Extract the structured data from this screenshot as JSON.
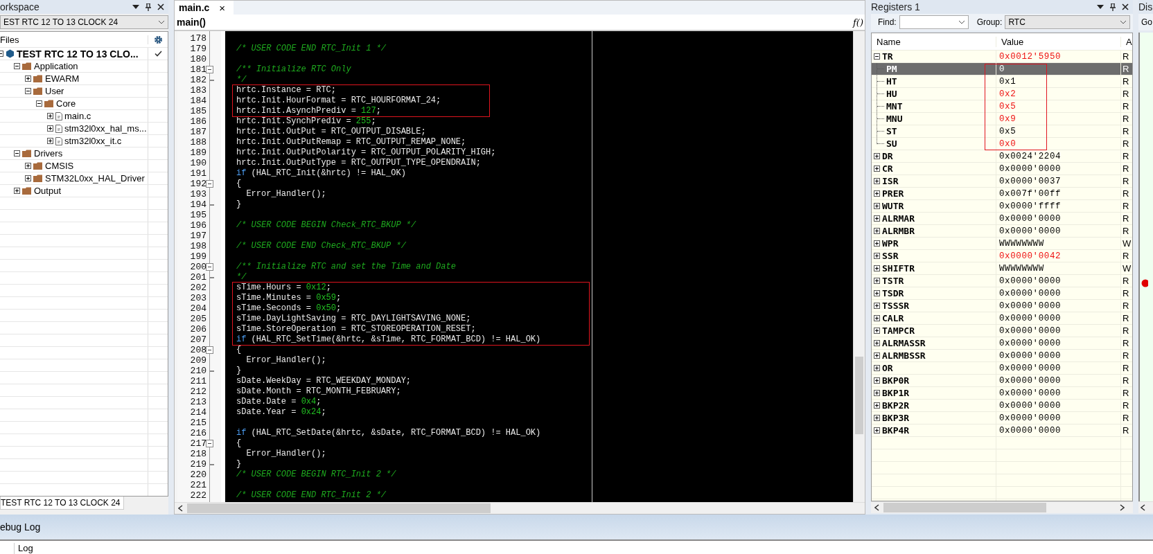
{
  "workspace": {
    "title": "orkspace",
    "configuration": "EST RTC 12 TO 13 CLOCK 24",
    "files_header": "Files",
    "tree": [
      {
        "label": "TEST RTC 12 TO 13 CLO...",
        "kind": "project",
        "expanded": true,
        "checked": true,
        "children": [
          {
            "label": "Application",
            "kind": "folder",
            "expanded": true,
            "children": [
              {
                "label": "EWARM",
                "kind": "folder",
                "expanded": false
              },
              {
                "label": "User",
                "kind": "folder",
                "expanded": true,
                "children": [
                  {
                    "label": "Core",
                    "kind": "folder",
                    "expanded": true,
                    "children": [
                      {
                        "label": "main.c",
                        "kind": "file",
                        "expanded": false
                      },
                      {
                        "label": "stm32l0xx_hal_ms...",
                        "kind": "file",
                        "expanded": false
                      },
                      {
                        "label": "stm32l0xx_it.c",
                        "kind": "file",
                        "expanded": false
                      }
                    ]
                  }
                ]
              }
            ]
          },
          {
            "label": "Drivers",
            "kind": "folder",
            "expanded": true,
            "children": [
              {
                "label": "CMSIS",
                "kind": "folder",
                "expanded": false
              },
              {
                "label": "STM32L0xx_HAL_Driver",
                "kind": "folder",
                "expanded": false
              }
            ]
          },
          {
            "label": "Output",
            "kind": "folder",
            "expanded": false
          }
        ]
      }
    ],
    "bottom_tab": "TEST RTC 12 TO 13 CLOCK 24"
  },
  "editor": {
    "tabs": [
      {
        "label": "main.c",
        "close": "×",
        "selected": true
      }
    ],
    "function": "main()",
    "function_button": "f()",
    "blocks": [
      {
        "boxed": false,
        "lines": [
          {
            "number": "178"
          },
          {
            "number": "179",
            "segments": [
              {
                "kind": "comment",
                "text": "/* USER CODE END RTC_Init 1 */"
              }
            ]
          },
          {
            "number": "180"
          },
          {
            "number": "181",
            "collapsible": true,
            "segments": [
              {
                "kind": "comment",
                "text": "/** Initialize RTC Only"
              }
            ]
          },
          {
            "number": "182",
            "block_end": true,
            "segments": [
              {
                "kind": "comment",
                "text": "*/"
              }
            ]
          }
        ]
      },
      {
        "boxed": true,
        "lines": [
          {
            "number": "183",
            "segments": [
              {
                "kind": "plain",
                "text": "hrtc.Instance = RTC;"
              }
            ]
          },
          {
            "number": "184",
            "segments": [
              {
                "kind": "plain",
                "text": "hrtc.Init.HourFormat = RTC_HOURFORMAT_24;"
              }
            ]
          },
          {
            "number": "185",
            "segments": [
              {
                "kind": "plain",
                "text": "hrtc.Init.AsynchPrediv = "
              },
              {
                "kind": "number",
                "text": "127"
              },
              {
                "kind": "plain",
                "text": ";"
              }
            ]
          }
        ]
      },
      {
        "boxed": false,
        "lines": [
          {
            "number": "186",
            "segments": [
              {
                "kind": "plain",
                "text": "hrtc.Init.SynchPrediv = "
              },
              {
                "kind": "number",
                "text": "255"
              },
              {
                "kind": "plain",
                "text": ";"
              }
            ]
          },
          {
            "number": "187",
            "segments": [
              {
                "kind": "plain",
                "text": "hrtc.Init.OutPut = RTC_OUTPUT_DISABLE;"
              }
            ]
          },
          {
            "number": "188",
            "segments": [
              {
                "kind": "plain",
                "text": "hrtc.Init.OutPutRemap = RTC_OUTPUT_REMAP_NONE;"
              }
            ]
          },
          {
            "number": "189",
            "segments": [
              {
                "kind": "plain",
                "text": "hrtc.Init.OutPutPolarity = RTC_OUTPUT_POLARITY_HIGH;"
              }
            ]
          },
          {
            "number": "190",
            "segments": [
              {
                "kind": "plain",
                "text": "hrtc.Init.OutPutType = RTC_OUTPUT_TYPE_OPENDRAIN;"
              }
            ]
          },
          {
            "number": "191",
            "segments": [
              {
                "kind": "keyword",
                "text": "if"
              },
              {
                "kind": "plain",
                "text": " (HAL_RTC_Init(&hrtc) != HAL_OK)"
              }
            ]
          },
          {
            "number": "192",
            "collapsible": true,
            "segments": [
              {
                "kind": "plain",
                "text": "{"
              }
            ]
          },
          {
            "number": "193",
            "segments": [
              {
                "kind": "plain",
                "text": "  Error_Handler();"
              }
            ]
          },
          {
            "number": "194",
            "block_end": true,
            "segments": [
              {
                "kind": "plain",
                "text": "}"
              }
            ]
          },
          {
            "number": "195"
          },
          {
            "number": "196",
            "segments": [
              {
                "kind": "comment",
                "text": "/* USER CODE BEGIN Check_RTC_BKUP */"
              }
            ]
          },
          {
            "number": "197"
          },
          {
            "number": "198",
            "segments": [
              {
                "kind": "comment",
                "text": "/* USER CODE END Check_RTC_BKUP */"
              }
            ]
          },
          {
            "number": "199"
          },
          {
            "number": "200",
            "collapsible": true,
            "segments": [
              {
                "kind": "comment",
                "text": "/** Initialize RTC and set the Time and Date"
              }
            ]
          },
          {
            "number": "201",
            "block_end": true,
            "segments": [
              {
                "kind": "comment",
                "text": "*/"
              }
            ]
          }
        ]
      },
      {
        "boxed": true,
        "lines": [
          {
            "number": "202",
            "segments": [
              {
                "kind": "plain",
                "text": "sTime.Hours = "
              },
              {
                "kind": "number",
                "text": "0x12"
              },
              {
                "kind": "plain",
                "text": ";"
              }
            ]
          },
          {
            "number": "203",
            "segments": [
              {
                "kind": "plain",
                "text": "sTime.Minutes = "
              },
              {
                "kind": "number",
                "text": "0x59"
              },
              {
                "kind": "plain",
                "text": ";"
              }
            ]
          },
          {
            "number": "204",
            "segments": [
              {
                "kind": "plain",
                "text": "sTime.Seconds = "
              },
              {
                "kind": "number",
                "text": "0x50"
              },
              {
                "kind": "plain",
                "text": ";"
              }
            ]
          },
          {
            "number": "205",
            "segments": [
              {
                "kind": "plain",
                "text": "sTime.DayLightSaving = RTC_DAYLIGHTSAVING_NONE;"
              }
            ]
          },
          {
            "number": "206",
            "segments": [
              {
                "kind": "plain",
                "text": "sTime.StoreOperation = RTC_STOREOPERATION_RESET;"
              }
            ]
          },
          {
            "number": "207",
            "segments": [
              {
                "kind": "keyword",
                "text": "if"
              },
              {
                "kind": "plain",
                "text": " (HAL_RTC_SetTime(&hrtc, &sTime, RTC_FORMAT_BCD) != HAL_OK)"
              }
            ]
          }
        ]
      },
      {
        "boxed": false,
        "lines": [
          {
            "number": "208",
            "collapsible": true,
            "segments": [
              {
                "kind": "plain",
                "text": "{"
              }
            ]
          },
          {
            "number": "209",
            "segments": [
              {
                "kind": "plain",
                "text": "  Error_Handler();"
              }
            ]
          },
          {
            "number": "210",
            "block_end": true,
            "segments": [
              {
                "kind": "plain",
                "text": "}"
              }
            ]
          },
          {
            "number": "211",
            "segments": [
              {
                "kind": "plain",
                "text": "sDate.WeekDay = RTC_WEEKDAY_MONDAY;"
              }
            ]
          },
          {
            "number": "212",
            "segments": [
              {
                "kind": "plain",
                "text": "sDate.Month = RTC_MONTH_FEBRUARY;"
              }
            ]
          },
          {
            "number": "213",
            "segments": [
              {
                "kind": "plain",
                "text": "sDate.Date = "
              },
              {
                "kind": "number",
                "text": "0x4"
              },
              {
                "kind": "plain",
                "text": ";"
              }
            ]
          },
          {
            "number": "214",
            "segments": [
              {
                "kind": "plain",
                "text": "sDate.Year = "
              },
              {
                "kind": "number",
                "text": "0x24"
              },
              {
                "kind": "plain",
                "text": ";"
              }
            ]
          },
          {
            "number": "215"
          },
          {
            "number": "216",
            "segments": [
              {
                "kind": "keyword",
                "text": "if"
              },
              {
                "kind": "plain",
                "text": " (HAL_RTC_SetDate(&hrtc, &sDate, RTC_FORMAT_BCD) != HAL_OK)"
              }
            ]
          },
          {
            "number": "217",
            "collapsible": true,
            "segments": [
              {
                "kind": "plain",
                "text": "{"
              }
            ]
          },
          {
            "number": "218",
            "segments": [
              {
                "kind": "plain",
                "text": "  Error_Handler();"
              }
            ]
          },
          {
            "number": "219",
            "block_end": true,
            "segments": [
              {
                "kind": "plain",
                "text": "}"
              }
            ]
          },
          {
            "number": "220",
            "segments": [
              {
                "kind": "comment",
                "text": "/* USER CODE BEGIN RTC_Init 2 */"
              }
            ]
          },
          {
            "number": "221"
          },
          {
            "number": "222",
            "segments": [
              {
                "kind": "comment",
                "text": "/* USER CODE END RTC_Init 2 */"
              }
            ]
          }
        ]
      }
    ]
  },
  "registers": {
    "title": "Registers 1",
    "find_label": "Find:",
    "group_label": "Group:",
    "group_value": "RTC",
    "columns": [
      "Name",
      "Value",
      "A"
    ],
    "rows": [
      {
        "name": "TR",
        "value": "0x0012'5950",
        "access": "R",
        "changed": true,
        "selected": false,
        "expanded": true,
        "children_boxed": true,
        "children": [
          {
            "name": "PM",
            "value": "0",
            "access": "R",
            "changed": false,
            "selected": true
          },
          {
            "name": "HT",
            "value": "0x1",
            "access": "R",
            "changed": false,
            "selected": false
          },
          {
            "name": "HU",
            "value": "0x2",
            "access": "R",
            "changed": true,
            "selected": false
          },
          {
            "name": "MNT",
            "value": "0x5",
            "access": "R",
            "changed": true,
            "selected": false
          },
          {
            "name": "MNU",
            "value": "0x9",
            "access": "R",
            "changed": true,
            "selected": false
          },
          {
            "name": "ST",
            "value": "0x5",
            "access": "R",
            "changed": false,
            "selected": false
          },
          {
            "name": "SU",
            "value": "0x0",
            "access": "R",
            "changed": true,
            "selected": false
          }
        ]
      },
      {
        "name": "DR",
        "value": "0x0024'2204",
        "access": "R",
        "changed": false,
        "selected": false,
        "expanded": false
      },
      {
        "name": "CR",
        "value": "0x0000'0000",
        "access": "R",
        "changed": false,
        "selected": false,
        "expanded": false
      },
      {
        "name": "ISR",
        "value": "0x0000'0037",
        "access": "R",
        "changed": false,
        "selected": false,
        "expanded": false
      },
      {
        "name": "PRER",
        "value": "0x007f'00ff",
        "access": "R",
        "changed": false,
        "selected": false,
        "expanded": false
      },
      {
        "name": "WUTR",
        "value": "0x0000'ffff",
        "access": "R",
        "changed": false,
        "selected": false,
        "expanded": false
      },
      {
        "name": "ALRMAR",
        "value": "0x0000'0000",
        "access": "R",
        "changed": false,
        "selected": false,
        "expanded": false
      },
      {
        "name": "ALRMBR",
        "value": "0x0000'0000",
        "access": "R",
        "changed": false,
        "selected": false,
        "expanded": false
      },
      {
        "name": "WPR",
        "value": "WWWWWWWW",
        "access": "W",
        "changed": false,
        "selected": false,
        "expanded": false
      },
      {
        "name": "SSR",
        "value": "0x0000'0042",
        "access": "R",
        "changed": true,
        "selected": false,
        "expanded": false
      },
      {
        "name": "SHIFTR",
        "value": "WWWWWWWW",
        "access": "W",
        "changed": false,
        "selected": false,
        "expanded": false
      },
      {
        "name": "TSTR",
        "value": "0x0000'0000",
        "access": "R",
        "changed": false,
        "selected": false,
        "expanded": false
      },
      {
        "name": "TSDR",
        "value": "0x0000'0000",
        "access": "R",
        "changed": false,
        "selected": false,
        "expanded": false
      },
      {
        "name": "TSSSR",
        "value": "0x0000'0000",
        "access": "R",
        "changed": false,
        "selected": false,
        "expanded": false
      },
      {
        "name": "CALR",
        "value": "0x0000'0000",
        "access": "R",
        "changed": false,
        "selected": false,
        "expanded": false
      },
      {
        "name": "TAMPCR",
        "value": "0x0000'0000",
        "access": "R",
        "changed": false,
        "selected": false,
        "expanded": false
      },
      {
        "name": "ALRMASSR",
        "value": "0x0000'0000",
        "access": "R",
        "changed": false,
        "selected": false,
        "expanded": false
      },
      {
        "name": "ALRMBSSR",
        "value": "0x0000'0000",
        "access": "R",
        "changed": false,
        "selected": false,
        "expanded": false
      },
      {
        "name": "OR",
        "value": "0x0000'0000",
        "access": "R",
        "changed": false,
        "selected": false,
        "expanded": false
      },
      {
        "name": "BKP0R",
        "value": "0x0000'0000",
        "access": "R",
        "changed": false,
        "selected": false,
        "expanded": false
      },
      {
        "name": "BKP1R",
        "value": "0x0000'0000",
        "access": "R",
        "changed": false,
        "selected": false,
        "expanded": false
      },
      {
        "name": "BKP2R",
        "value": "0x0000'0000",
        "access": "R",
        "changed": false,
        "selected": false,
        "expanded": false
      },
      {
        "name": "BKP3R",
        "value": "0x0000'0000",
        "access": "R",
        "changed": false,
        "selected": false,
        "expanded": false
      },
      {
        "name": "BKP4R",
        "value": "0x0000'0000",
        "access": "R",
        "changed": false,
        "selected": false,
        "expanded": false
      }
    ]
  },
  "disassembly": {
    "title": "Dis",
    "goto_label": "Go"
  },
  "debug_log": {
    "title": "ebug Log",
    "column": "Log"
  }
}
